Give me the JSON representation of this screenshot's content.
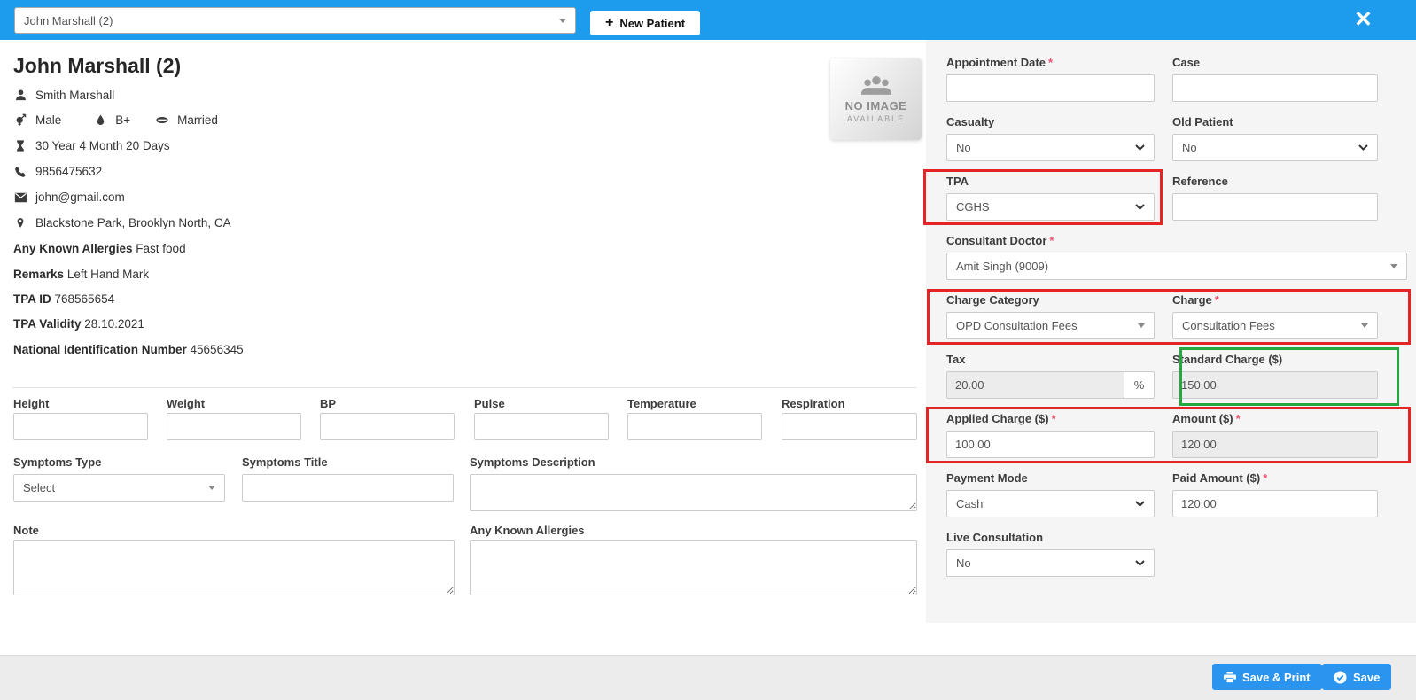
{
  "colors": {
    "topbar_blue": "#1d9bec",
    "button_blue": "#2b94ef",
    "highlight_red": "#e42525",
    "highlight_green": "#23a93f"
  },
  "topbar": {
    "patient_selected": "John Marshall (2)",
    "new_patient_plus": "+",
    "new_patient_label": "New Patient",
    "close_icon": "✕"
  },
  "patient": {
    "name": "John Marshall (2)",
    "guardian": "Smith Marshall",
    "gender": "Male",
    "blood_group": "B+",
    "marital_status": "Married",
    "age": "30 Year 4 Month 20 Days",
    "phone": "9856475632",
    "email": "john@gmail.com",
    "address": "Blackstone Park, Brooklyn North, CA",
    "known_allergies_label": "Any Known Allergies",
    "known_allergies": "Fast food",
    "remarks_label": "Remarks",
    "remarks": "Left Hand Mark",
    "tpa_id_label": "TPA ID",
    "tpa_id": "768565654",
    "tpa_validity_label": "TPA Validity",
    "tpa_validity": "28.10.2021",
    "nin_label": "National Identification Number",
    "nin": "45656345",
    "photo_placeholder": {
      "line1": "NO IMAGE",
      "line2": "AVAILABLE"
    }
  },
  "vitals": {
    "fields": [
      {
        "label": "Height",
        "value": ""
      },
      {
        "label": "Weight",
        "value": ""
      },
      {
        "label": "BP",
        "value": ""
      },
      {
        "label": "Pulse",
        "value": ""
      },
      {
        "label": "Temperature",
        "value": ""
      },
      {
        "label": "Respiration",
        "value": ""
      }
    ]
  },
  "symptoms": {
    "type_label": "Symptoms Type",
    "type_value": "Select",
    "title_label": "Symptoms Title",
    "title_value": "",
    "description_label": "Symptoms Description",
    "description_value": ""
  },
  "notes": {
    "note_label": "Note",
    "note_value": "",
    "allergies_label": "Any Known Allergies",
    "allergies_value": ""
  },
  "appointment": {
    "required_mark": "*",
    "appointment_date": {
      "label": "Appointment Date",
      "value": ""
    },
    "case": {
      "label": "Case",
      "value": ""
    },
    "casualty": {
      "label": "Casualty",
      "value": "No"
    },
    "old_patient": {
      "label": "Old Patient",
      "value": "No"
    },
    "tpa": {
      "label": "TPA",
      "value": "CGHS"
    },
    "reference": {
      "label": "Reference",
      "value": ""
    },
    "consultant_doctor": {
      "label": "Consultant Doctor",
      "value": "Amit Singh (9009)"
    },
    "charge_category": {
      "label": "Charge Category",
      "value": "OPD Consultation Fees"
    },
    "charge": {
      "label": "Charge",
      "value": "Consultation Fees"
    },
    "tax": {
      "label": "Tax",
      "value": "20.00",
      "suffix": "%"
    },
    "standard_charge": {
      "label": "Standard Charge ($)",
      "value": "150.00"
    },
    "applied_charge": {
      "label": "Applied Charge ($)",
      "value": "100.00"
    },
    "amount": {
      "label": "Amount ($)",
      "value": "120.00"
    },
    "payment_mode": {
      "label": "Payment Mode",
      "value": "Cash"
    },
    "paid_amount": {
      "label": "Paid Amount ($)",
      "value": "120.00"
    },
    "live_consultation": {
      "label": "Live Consultation",
      "value": "No"
    }
  },
  "footer": {
    "save_print_label": "Save & Print",
    "save_label": "Save"
  }
}
